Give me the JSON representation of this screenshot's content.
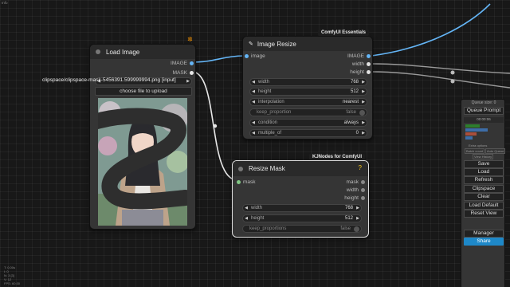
{
  "top_left_label": "Info",
  "load_image": {
    "title": "Load Image",
    "outputs": [
      "IMAGE",
      "MASK"
    ],
    "image_value": "clipspace/clipspace-mask-5456391.599999994.png [input]",
    "upload_label": "choose file to upload"
  },
  "image_resize": {
    "title": "Image Resize",
    "badge": "ComfyUI Essentials",
    "input": "image",
    "outputs": [
      "IMAGE",
      "width",
      "height"
    ],
    "widgets": [
      {
        "label": "width",
        "value": "768"
      },
      {
        "label": "height",
        "value": "512"
      },
      {
        "label": "interpolation",
        "value": "nearest"
      },
      {
        "label": "keep_proportion",
        "value": "false",
        "toggle": true
      },
      {
        "label": "condition",
        "value": "always"
      },
      {
        "label": "multiple_of",
        "value": "0"
      }
    ]
  },
  "resize_mask": {
    "title": "Resize Mask",
    "badge": "KJNodes for ComfyUI",
    "help": "?",
    "input": "mask",
    "outputs": [
      "mask",
      "width",
      "height"
    ],
    "widgets": [
      {
        "label": "width",
        "value": "768"
      },
      {
        "label": "height",
        "value": "512"
      },
      {
        "label": "keep_proportions",
        "value": "false",
        "toggle": true
      }
    ]
  },
  "queue_menu": {
    "title": "Queue size: 0",
    "queue_prompt": "Queue Prompt",
    "timer": "00:00:06",
    "extra_options": "Extra options",
    "auto_queue": "Auto Queue",
    "batch": "Batch count",
    "view_history": "View History",
    "buttons": [
      "Save",
      "Load",
      "Refresh",
      "Clipspace",
      "Clear",
      "Load Default",
      "Reset View"
    ],
    "manager": "Manager",
    "share": "Share"
  },
  "bottom_left_info": [
    "T: 0.00s",
    "I: 0",
    "N: 3 [3]",
    "V: 12",
    "FPS: 60.00"
  ]
}
